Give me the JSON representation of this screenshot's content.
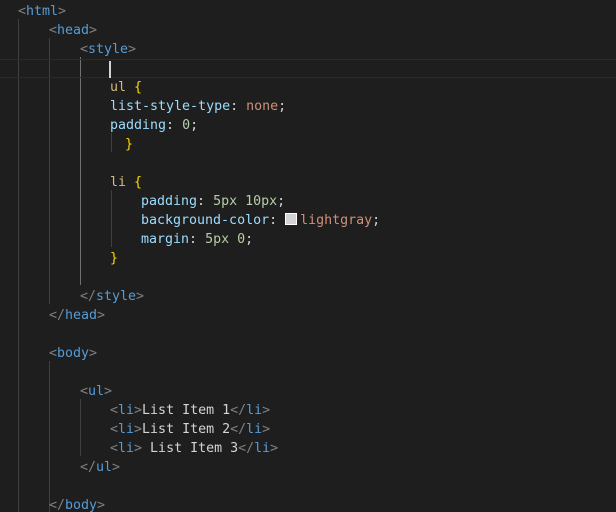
{
  "editor": {
    "html_open": "html",
    "head_open": "head",
    "style_open": "style",
    "ul_selector": "ul",
    "ul_brace_open": "{",
    "ul_prop1": "list-style-type",
    "ul_val1": "none",
    "ul_prop2": "padding",
    "ul_val2": "0",
    "ul_brace_close": "}",
    "li_selector": "li",
    "li_brace_open": "{",
    "li_prop1": "padding",
    "li_val1": "5px 10px",
    "li_prop2": "background-color",
    "li_val2": "lightgray",
    "li_prop3": "margin",
    "li_val3": "5px 0",
    "li_brace_close": "}",
    "style_close": "style",
    "head_close": "head",
    "body_open": "body",
    "ul_open": "ul",
    "li_tag": "li",
    "items": [
      "List Item 1",
      "List Item 2",
      " List Item 3"
    ],
    "ul_close": "ul",
    "body_close": "body",
    "swatch_color": "#d3d3d3"
  }
}
